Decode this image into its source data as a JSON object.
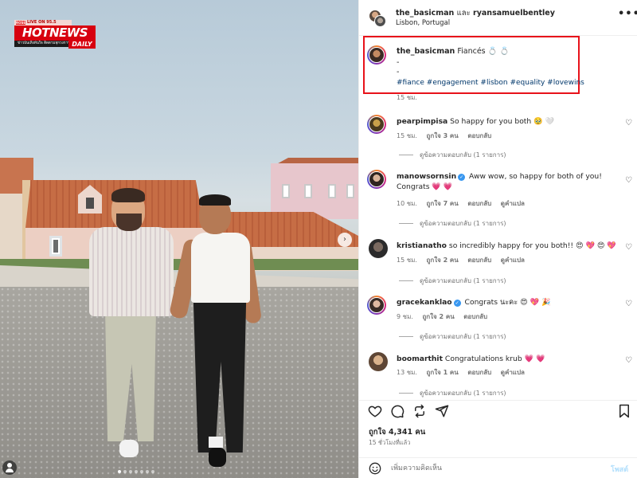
{
  "photo": {
    "logo": {
      "top_pill": "ROSE",
      "top_text": "LIVE ON 95.5",
      "main": "HOTNEWS",
      "sub": "ข่าวบันเทิงทันใจ ติดตามทุกวงการ",
      "daily": "DAILY"
    },
    "carousel_dots": 7,
    "active_dot": 0,
    "next_icon": "chevron-right-icon"
  },
  "header": {
    "user1": "the_basicman",
    "and_word": "และ",
    "user2": "ryansamuelbentley",
    "location": "Lisbon, Portugal",
    "more_icon": "more-horizontal-icon",
    "more_glyph": "•••"
  },
  "caption": {
    "username": "the_basicman",
    "text": "Fiancés 💍 💍",
    "line2": "-",
    "line3": "-",
    "hashtags": "#fiance #engagement #lisbon #equality #lovewins",
    "time": "15 ชม."
  },
  "comments": [
    {
      "username": "pearpimpisa",
      "text": "So happy for you both 🥹 🤍",
      "verified": false,
      "time": "15 ชม.",
      "likes": "ถูกใจ 3 คน",
      "reply": "ตอบกลับ",
      "translate": "",
      "replies": "ดูข้อความตอบกลับ (1 รายการ)"
    },
    {
      "username": "manowsornsin",
      "text": "Aww wow, so happy for both of you! Congrats 💗 💗",
      "verified": true,
      "time": "10 ชม.",
      "likes": "ถูกใจ 7 คน",
      "reply": "ตอบกลับ",
      "translate": "ดูคำแปล",
      "replies": "ดูข้อความตอบกลับ (1 รายการ)"
    },
    {
      "username": "kristianatho",
      "text": "so incredibly happy for you both!! 😍 💖 😍 💖",
      "verified": false,
      "time": "15 ชม.",
      "likes": "ถูกใจ 2 คน",
      "reply": "ตอบกลับ",
      "translate": "ดูคำแปล",
      "replies": "ดูข้อความตอบกลับ (1 รายการ)"
    },
    {
      "username": "gracekanklao",
      "text": "Congrats นะคะ 😍 💖 🎉",
      "verified": true,
      "time": "9 ชม.",
      "likes": "ถูกใจ 2 คน",
      "reply": "ตอบกลับ",
      "translate": "",
      "replies": "ดูข้อความตอบกลับ (1 รายการ)"
    },
    {
      "username": "boomarthit",
      "text": "Congratulations krub 💗 💗",
      "verified": false,
      "time": "13 ชม.",
      "likes": "ถูกใจ 1 คน",
      "reply": "ตอบกลับ",
      "translate": "ดูคำแปล",
      "replies": "ดูข้อความตอบกลับ (1 รายการ)"
    }
  ],
  "actions": {
    "like_icon": "heart-icon",
    "comment_icon": "comment-icon",
    "share_icon": "repost-icon",
    "send_icon": "send-icon",
    "save_icon": "bookmark-icon"
  },
  "likes_label": "ถูกใจ 4,341 คน",
  "posted_ago": "15 ชั่วโมงที่แล้ว",
  "comment_box": {
    "placeholder": "เพิ่มความคิดเห็น",
    "post_label": "โพสต์",
    "emoji_icon": "emoji-icon"
  },
  "colors": {
    "highlight_border": "#e8121a",
    "hashtag": "#00376b",
    "verified": "#3897f0",
    "post_disabled": "#b2dffc",
    "logo_red": "#d7000f"
  }
}
